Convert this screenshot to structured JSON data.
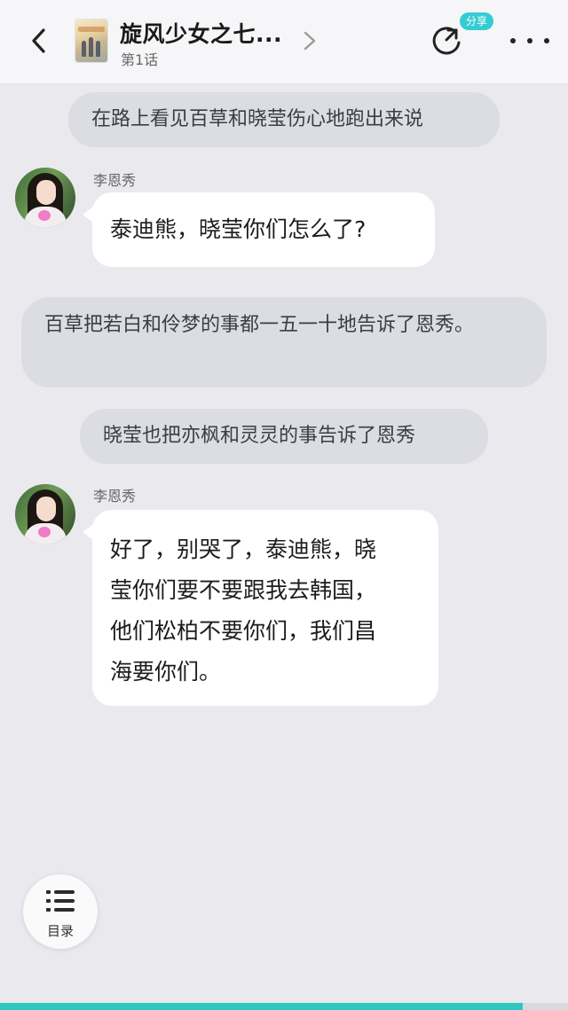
{
  "header": {
    "title": "旋风少女之七...",
    "episode": "第1话",
    "share_badge": "分享",
    "icons": {
      "back": "chevron-left-icon",
      "title_arrow": "chevron-right-icon",
      "share": "share-icon",
      "more": "more-icon"
    }
  },
  "messages": [
    {
      "kind": "narration",
      "text": "在路上看见百草和晓莹伤心地跑出来说"
    },
    {
      "kind": "dialogue",
      "speaker": "李恩秀",
      "text": "泰迪熊，晓莹你们怎么了?"
    },
    {
      "kind": "narration",
      "text": "百草把若白和伶梦的事都一五一十地告诉了恩秀。"
    },
    {
      "kind": "narration",
      "text": "晓莹也把亦枫和灵灵的事告诉了恩秀"
    },
    {
      "kind": "dialogue",
      "speaker": "李恩秀",
      "lines": [
        "好了，别哭了，泰迪熊，晓",
        "莹你们要不要跟我去韩国，",
        "他们松柏不要你们，我们昌",
        "海要你们。"
      ]
    }
  ],
  "toc": {
    "label": "目录",
    "icon": "list-icon"
  },
  "reading_progress": 0.92,
  "colors": {
    "background": "#e9e9ee",
    "narration_bubble": "#dcdce3",
    "dialogue_bubble": "#ffffff",
    "accent": "#2fc7c2",
    "share_badge": "#33ccd3"
  }
}
